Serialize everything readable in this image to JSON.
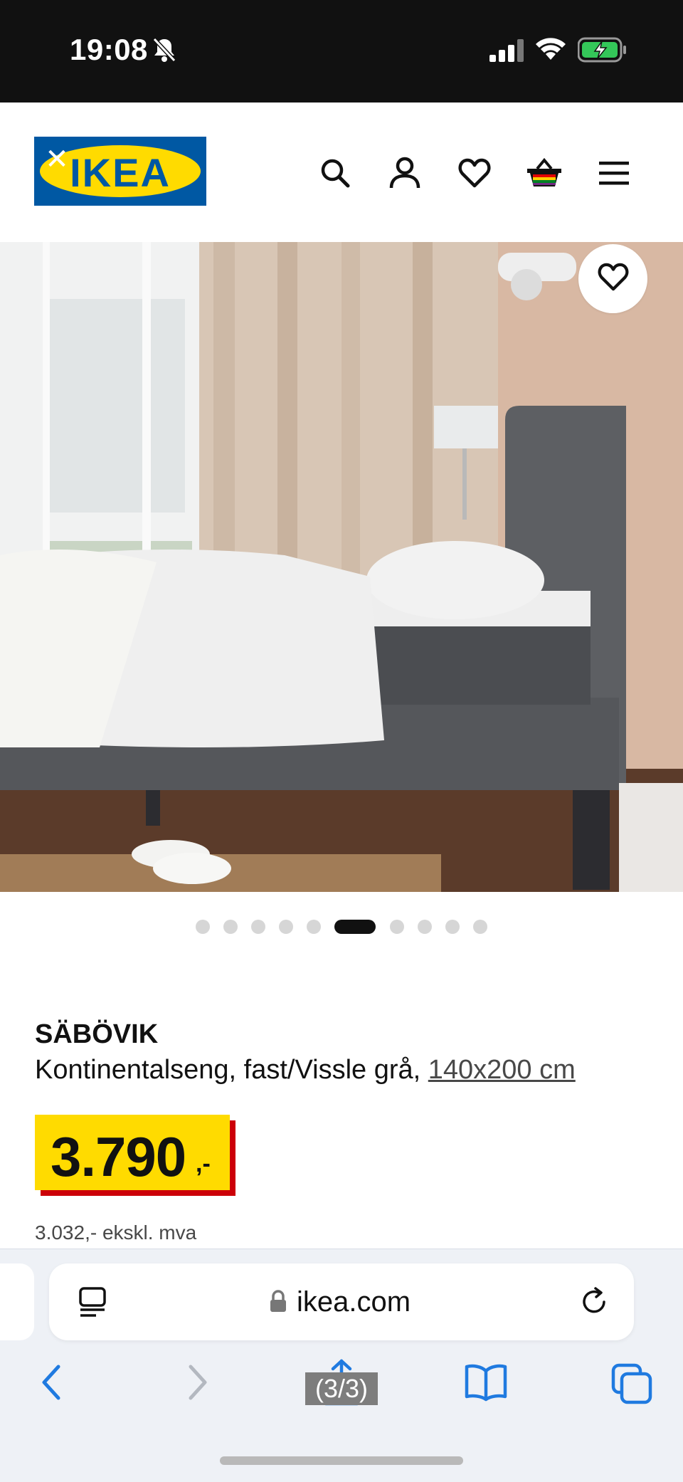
{
  "status_bar": {
    "time": "19:08"
  },
  "header": {
    "logo_text": "IKEA",
    "logo_close": "✕"
  },
  "product": {
    "name": "SÄBÖVIK",
    "description": "Kontinentalseng, fast/Vissle grå,",
    "size": "140x200 cm",
    "price": "3.790",
    "price_suffix": ",-",
    "price_excl_vat": "3.032,- ekskl. mva"
  },
  "carousel": {
    "total": 10,
    "active_index": 5
  },
  "browser": {
    "url": "ikea.com",
    "page_count": "(3/3)"
  },
  "colors": {
    "ikea_blue": "#0058a3",
    "ikea_yellow": "#ffdb00",
    "price_shadow_red": "#cc0008",
    "ios_blue": "#1f7ae0"
  }
}
